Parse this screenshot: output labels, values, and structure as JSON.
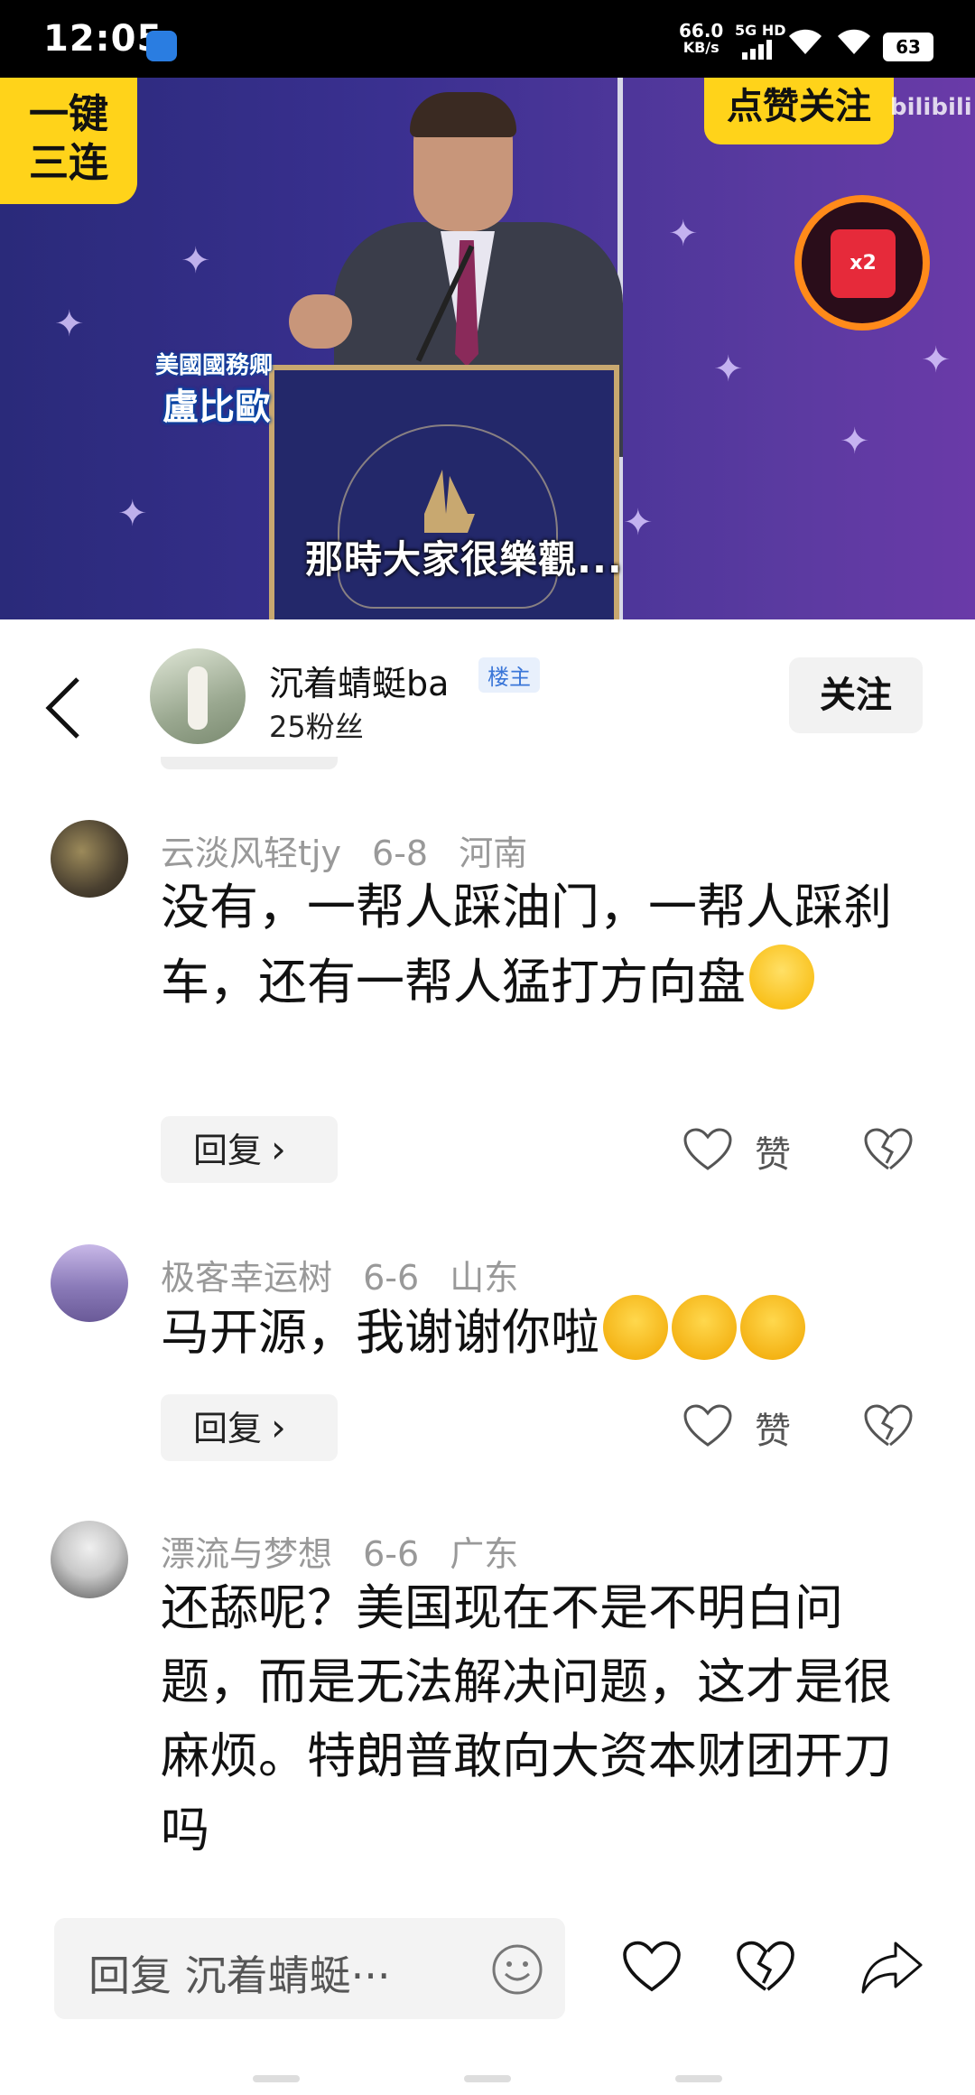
{
  "status_bar": {
    "time": "12:05",
    "net_speed": "66.0",
    "net_unit": "KB/s",
    "network": "5G HD",
    "battery": "63"
  },
  "video": {
    "badge_left": "一键\n三连",
    "badge_right": "点赞关注",
    "watermark": "bilibili",
    "caption_title": "美國國務卿",
    "caption_name": "盧比歐",
    "subtitle": "那時大家很樂觀...",
    "red_packet": "x2"
  },
  "header": {
    "user_name": "沉着蜻蜓ba",
    "badge": "楼主",
    "fans": "25粉丝",
    "follow_label": "关注"
  },
  "comments": [
    {
      "user": "云淡风轻tjy",
      "date": "6-8",
      "location": "河南",
      "text": "没有，一帮人踩油门，一帮人踩刹车，还有一帮人猛打方向盘",
      "emoji": "grin",
      "reply_label": "回复",
      "like_label": "赞"
    },
    {
      "user": "极客幸运树",
      "date": "6-6",
      "location": "山东",
      "text": "马开源，我谢谢你啦",
      "emoji": "cry",
      "reply_label": "回复",
      "like_label": "赞"
    },
    {
      "user": "漂流与梦想",
      "date": "6-6",
      "location": "广东",
      "text": "还舔呢？美国现在不是不明白问题，而是无法解决问题，这才是很麻烦。特朗普敢向大资本财团开刀吗"
    }
  ],
  "bottom_bar": {
    "input_placeholder": "回复 沉着蜻蜓···"
  },
  "colors": {
    "accent_yellow": "#ffd31a",
    "badge_blue": "#3a76d8",
    "meta_gray": "#999999"
  }
}
